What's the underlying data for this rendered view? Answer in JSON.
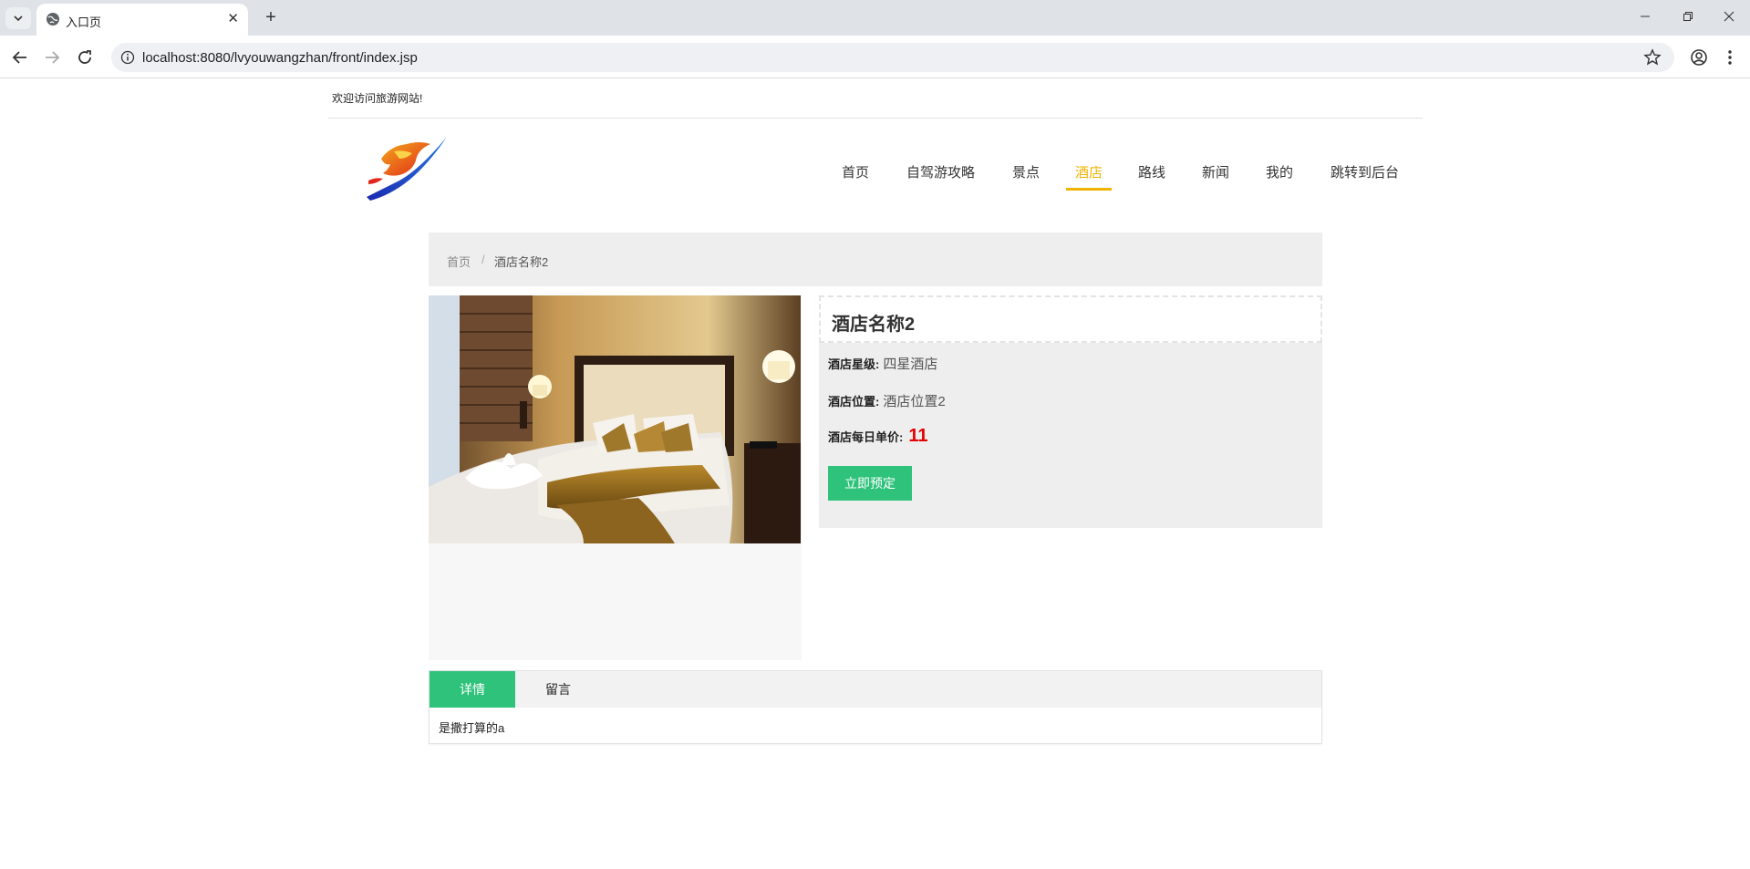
{
  "browser": {
    "tab_title": "入口页",
    "url": "localhost:8080/lvyouwangzhan/front/index.jsp"
  },
  "topbar": {
    "welcome": "欢迎访问旅游网站!"
  },
  "nav": {
    "items": [
      "首页",
      "自驾游攻略",
      "景点",
      "酒店",
      "路线",
      "新闻",
      "我的",
      "跳转到后台"
    ],
    "active": "酒店",
    "active_color": "#f0b400"
  },
  "breadcrumb": {
    "home": "首页",
    "separator": "/",
    "current": "酒店名称2"
  },
  "hotel": {
    "name": "酒店名称2",
    "star_label": "酒店星级:",
    "star_value": "四星酒店",
    "location_label": "酒店位置:",
    "location_value": "酒店位置2",
    "price_label": "酒店每日单价:",
    "price_value": "11",
    "book_button": "立即预定"
  },
  "detail_tabs": {
    "tabs": [
      "详情",
      "留言"
    ],
    "active": "详情",
    "content": "是撒打算的a"
  },
  "colors": {
    "accent_green": "#2fc27b",
    "price_red": "#e60000"
  }
}
